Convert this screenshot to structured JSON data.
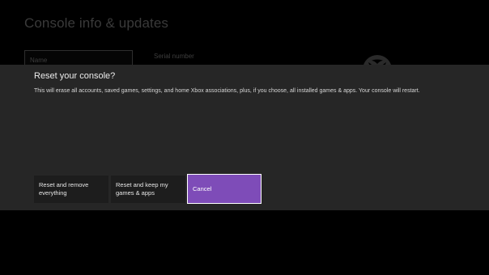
{
  "page": {
    "title": "Console info & updates",
    "name_field_label": "Name",
    "serial_label": "Serial number"
  },
  "icons": {
    "xbox_logo": "xbox-logo-icon"
  },
  "dialog": {
    "title": "Reset your console?",
    "message": "This will erase all accounts, saved games, settings, and home Xbox associations, plus, if you choose, all installed games & apps. Your console will restart.",
    "buttons": {
      "reset_remove_line1": "Reset and remove",
      "reset_remove_line2": "everything",
      "reset_keep_line1": "Reset and keep my",
      "reset_keep_line2": "games & apps",
      "cancel": "Cancel"
    }
  },
  "colors": {
    "background": "#000000",
    "dialog_background": "#262626",
    "button_background": "#1d1d1d",
    "accent": "#7e4cb8"
  }
}
